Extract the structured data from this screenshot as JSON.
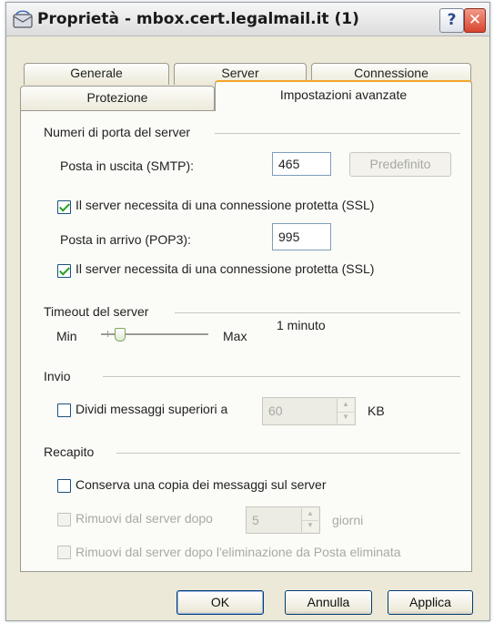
{
  "window": {
    "title": "Proprietà - mbox.cert.legalmail.it (1)",
    "help": "?",
    "close": "✕"
  },
  "tabs": {
    "row1": [
      "Generale",
      "Server",
      "Connessione"
    ],
    "row2": [
      "Protezione",
      "Impostazioni avanzate"
    ],
    "active": "Impostazioni avanzate"
  },
  "ports": {
    "group": "Numeri di porta del server",
    "smtp_label": "Posta in uscita (SMTP):",
    "smtp_value": "465",
    "default_button": "Predefinito",
    "smtp_ssl_label": "Il server necessita di una connessione protetta (SSL)",
    "smtp_ssl_checked": true,
    "pop3_label": "Posta in arrivo (POP3):",
    "pop3_value": "995",
    "pop3_ssl_label": "Il server necessita di una connessione protetta (SSL)",
    "pop3_ssl_checked": true
  },
  "timeout": {
    "group": "Timeout del server",
    "value_text": "1 minuto",
    "min_label": "Min",
    "max_label": "Max",
    "slider_level": 0.15
  },
  "send": {
    "group": "Invio",
    "split_label": "Dividi messaggi superiori a",
    "split_checked": false,
    "split_value": "60",
    "split_unit": "KB"
  },
  "delivery": {
    "group": "Recapito",
    "keep_copy_label": "Conserva una copia dei messaggi sul server",
    "keep_copy_checked": false,
    "remove_after_label": "Rimuovi dal server dopo",
    "remove_after_value": "5",
    "remove_after_unit": "giorni",
    "remove_deleted_label": "Rimuovi dal server dopo l'eliminazione da Posta eliminata"
  },
  "footer": {
    "ok": "OK",
    "cancel": "Annulla",
    "apply": "Applica"
  },
  "colors": {
    "window_bg": "#ece9d8",
    "panel_bg": "#fbfbf8",
    "active_tab_accent": "#f4a52b",
    "close_red": "#d9442e",
    "check_green": "#21a121"
  },
  "icons": [
    "mail-account-icon",
    "help-icon",
    "close-icon",
    "checkmark-icon",
    "spin-up-icon",
    "spin-down-icon"
  ]
}
